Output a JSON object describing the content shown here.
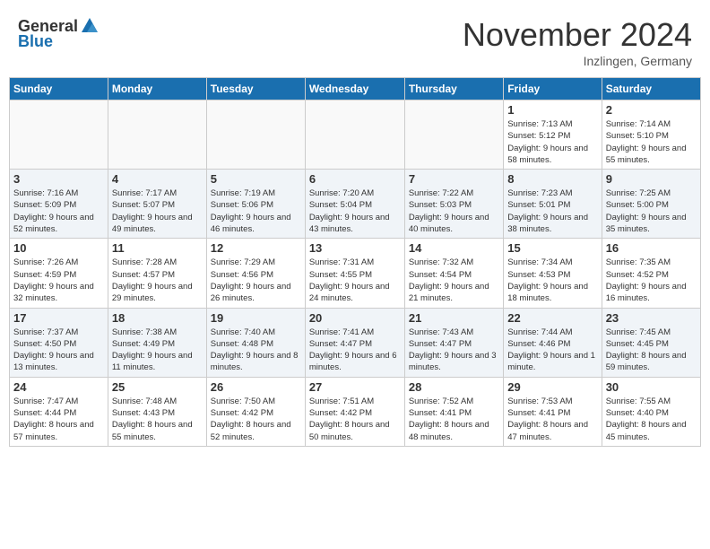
{
  "header": {
    "logo_general": "General",
    "logo_blue": "Blue",
    "month_title": "November 2024",
    "location": "Inzlingen, Germany"
  },
  "weekdays": [
    "Sunday",
    "Monday",
    "Tuesday",
    "Wednesday",
    "Thursday",
    "Friday",
    "Saturday"
  ],
  "weeks": [
    [
      {
        "day": "",
        "info": ""
      },
      {
        "day": "",
        "info": ""
      },
      {
        "day": "",
        "info": ""
      },
      {
        "day": "",
        "info": ""
      },
      {
        "day": "",
        "info": ""
      },
      {
        "day": "1",
        "info": "Sunrise: 7:13 AM\nSunset: 5:12 PM\nDaylight: 9 hours and 58 minutes."
      },
      {
        "day": "2",
        "info": "Sunrise: 7:14 AM\nSunset: 5:10 PM\nDaylight: 9 hours and 55 minutes."
      }
    ],
    [
      {
        "day": "3",
        "info": "Sunrise: 7:16 AM\nSunset: 5:09 PM\nDaylight: 9 hours and 52 minutes."
      },
      {
        "day": "4",
        "info": "Sunrise: 7:17 AM\nSunset: 5:07 PM\nDaylight: 9 hours and 49 minutes."
      },
      {
        "day": "5",
        "info": "Sunrise: 7:19 AM\nSunset: 5:06 PM\nDaylight: 9 hours and 46 minutes."
      },
      {
        "day": "6",
        "info": "Sunrise: 7:20 AM\nSunset: 5:04 PM\nDaylight: 9 hours and 43 minutes."
      },
      {
        "day": "7",
        "info": "Sunrise: 7:22 AM\nSunset: 5:03 PM\nDaylight: 9 hours and 40 minutes."
      },
      {
        "day": "8",
        "info": "Sunrise: 7:23 AM\nSunset: 5:01 PM\nDaylight: 9 hours and 38 minutes."
      },
      {
        "day": "9",
        "info": "Sunrise: 7:25 AM\nSunset: 5:00 PM\nDaylight: 9 hours and 35 minutes."
      }
    ],
    [
      {
        "day": "10",
        "info": "Sunrise: 7:26 AM\nSunset: 4:59 PM\nDaylight: 9 hours and 32 minutes."
      },
      {
        "day": "11",
        "info": "Sunrise: 7:28 AM\nSunset: 4:57 PM\nDaylight: 9 hours and 29 minutes."
      },
      {
        "day": "12",
        "info": "Sunrise: 7:29 AM\nSunset: 4:56 PM\nDaylight: 9 hours and 26 minutes."
      },
      {
        "day": "13",
        "info": "Sunrise: 7:31 AM\nSunset: 4:55 PM\nDaylight: 9 hours and 24 minutes."
      },
      {
        "day": "14",
        "info": "Sunrise: 7:32 AM\nSunset: 4:54 PM\nDaylight: 9 hours and 21 minutes."
      },
      {
        "day": "15",
        "info": "Sunrise: 7:34 AM\nSunset: 4:53 PM\nDaylight: 9 hours and 18 minutes."
      },
      {
        "day": "16",
        "info": "Sunrise: 7:35 AM\nSunset: 4:52 PM\nDaylight: 9 hours and 16 minutes."
      }
    ],
    [
      {
        "day": "17",
        "info": "Sunrise: 7:37 AM\nSunset: 4:50 PM\nDaylight: 9 hours and 13 minutes."
      },
      {
        "day": "18",
        "info": "Sunrise: 7:38 AM\nSunset: 4:49 PM\nDaylight: 9 hours and 11 minutes."
      },
      {
        "day": "19",
        "info": "Sunrise: 7:40 AM\nSunset: 4:48 PM\nDaylight: 9 hours and 8 minutes."
      },
      {
        "day": "20",
        "info": "Sunrise: 7:41 AM\nSunset: 4:47 PM\nDaylight: 9 hours and 6 minutes."
      },
      {
        "day": "21",
        "info": "Sunrise: 7:43 AM\nSunset: 4:47 PM\nDaylight: 9 hours and 3 minutes."
      },
      {
        "day": "22",
        "info": "Sunrise: 7:44 AM\nSunset: 4:46 PM\nDaylight: 9 hours and 1 minute."
      },
      {
        "day": "23",
        "info": "Sunrise: 7:45 AM\nSunset: 4:45 PM\nDaylight: 8 hours and 59 minutes."
      }
    ],
    [
      {
        "day": "24",
        "info": "Sunrise: 7:47 AM\nSunset: 4:44 PM\nDaylight: 8 hours and 57 minutes."
      },
      {
        "day": "25",
        "info": "Sunrise: 7:48 AM\nSunset: 4:43 PM\nDaylight: 8 hours and 55 minutes."
      },
      {
        "day": "26",
        "info": "Sunrise: 7:50 AM\nSunset: 4:42 PM\nDaylight: 8 hours and 52 minutes."
      },
      {
        "day": "27",
        "info": "Sunrise: 7:51 AM\nSunset: 4:42 PM\nDaylight: 8 hours and 50 minutes."
      },
      {
        "day": "28",
        "info": "Sunrise: 7:52 AM\nSunset: 4:41 PM\nDaylight: 8 hours and 48 minutes."
      },
      {
        "day": "29",
        "info": "Sunrise: 7:53 AM\nSunset: 4:41 PM\nDaylight: 8 hours and 47 minutes."
      },
      {
        "day": "30",
        "info": "Sunrise: 7:55 AM\nSunset: 4:40 PM\nDaylight: 8 hours and 45 minutes."
      }
    ]
  ]
}
